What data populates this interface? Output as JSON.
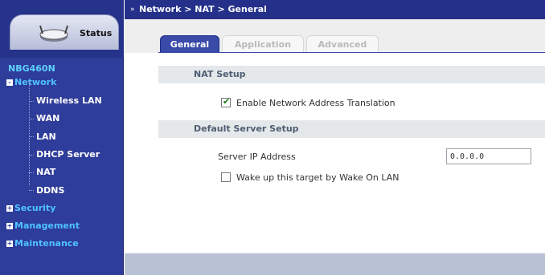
{
  "status": {
    "label": "Status"
  },
  "sidebar": {
    "device": "NBG460N",
    "network": {
      "label": "Network",
      "toggle": "-"
    },
    "network_items": [
      "Wireless LAN",
      "WAN",
      "LAN",
      "DHCP Server",
      "NAT",
      "DDNS"
    ],
    "collapsed": [
      {
        "label": "Security",
        "toggle": "+"
      },
      {
        "label": "Management",
        "toggle": "+"
      },
      {
        "label": "Maintenance",
        "toggle": "+"
      }
    ]
  },
  "topbar": {
    "breadcrumb": "Network > NAT > General",
    "icon": "double-chevron-icon"
  },
  "tabs": [
    "General",
    "Application",
    "Advanced"
  ],
  "nat_setup": {
    "title": "NAT Setup",
    "enable_label": "Enable Network Address Translation",
    "enable_checked": true
  },
  "default_server": {
    "title": "Default Server Setup",
    "ip_label": "Server IP Address",
    "ip_value": "0.0.0.0",
    "wol_label": "Wake up this target by Wake On LAN",
    "wol_checked": false
  },
  "colors": {
    "sidebar": "#2e3c9a",
    "accent": "#3a4aa8",
    "link": "#4fc3ff"
  }
}
